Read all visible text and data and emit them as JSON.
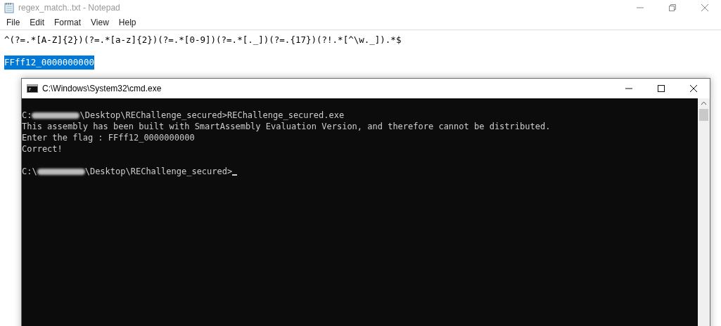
{
  "notepad": {
    "title": "regex_match..txt - Notepad",
    "menu": [
      "File",
      "Edit",
      "Format",
      "View",
      "Help"
    ],
    "lines": [
      {
        "text": "^(?=.*[A-Z]{2})(?=.*[a-z]{2})(?=.*[0-9])(?=.*[._])(?=.{17})(?!.*[^\\w._]).*$",
        "selected": false
      },
      {
        "text": "FFff12_0000000000",
        "selected": true
      }
    ]
  },
  "cmd": {
    "title": "C:\\Windows\\System32\\cmd.exe",
    "lines": [
      {
        "kind": "redacted",
        "prefix": "C:",
        "suffix": "\\Desktop\\REChallenge_secured>REChallenge_secured.exe"
      },
      {
        "kind": "plain",
        "text": "This assembly has been built with SmartAssembly Evaluation Version, and therefore cannot be distributed."
      },
      {
        "kind": "plain",
        "text": "Enter the flag : FFff12_0000000000"
      },
      {
        "kind": "plain",
        "text": "Correct!"
      },
      {
        "kind": "blank"
      },
      {
        "kind": "redacted",
        "prefix": "C:\\",
        "suffix": "\\Desktop\\REChallenge_secured>",
        "cursor": true
      }
    ]
  }
}
